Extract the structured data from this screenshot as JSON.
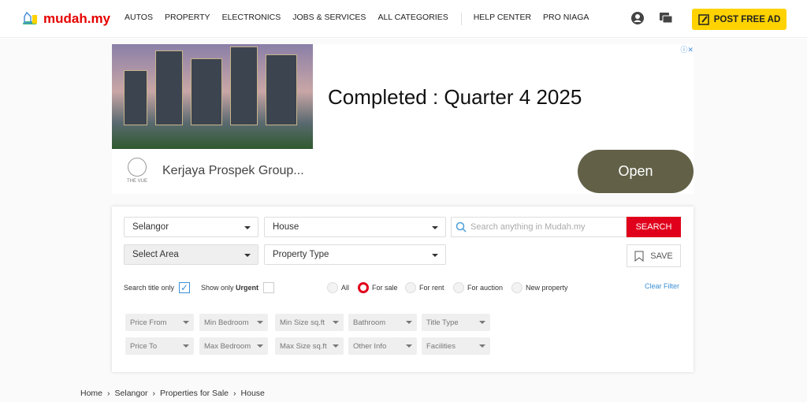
{
  "header": {
    "logo": "mudah.my",
    "nav": [
      "AUTOS",
      "PROPERTY",
      "ELECTRONICS",
      "JOBS & SERVICES",
      "ALL CATEGORIES"
    ],
    "nav2": [
      "HELP CENTER",
      "PRO NIAGA"
    ],
    "post_label": "POST FREE AD",
    "post_color": "#ffd200"
  },
  "ad": {
    "headline": "Completed : Quarter 4 2025",
    "advertiser": "Kerjaya Prospek Group...",
    "open_label": "Open",
    "logo_text": "THE VUE"
  },
  "search": {
    "state": "Selangor",
    "category": "House",
    "area": "Select Area",
    "property_type": "Property Type",
    "placeholder": "Search anything in Mudah.my",
    "search_label": "SEARCH",
    "save_label": "SAVE",
    "search_title_only": "Search title only",
    "show_only": "Show only",
    "urgent": "Urgent",
    "clear": "Clear Filter",
    "radios": [
      "All",
      "For sale",
      "For rent",
      "For auction",
      "New property"
    ],
    "selected_radio": "For sale",
    "filters_row1": [
      "Price From",
      "Min Bedroom",
      "Min Size sq.ft",
      "Bathroom",
      "Title Type"
    ],
    "filters_row2": [
      "Price To",
      "Max Bedroom",
      "Max Size sq.ft",
      "Other Info",
      "Facilities"
    ]
  },
  "breadcrumb": [
    "Home",
    "Selangor",
    "Properties for Sale",
    "House"
  ]
}
